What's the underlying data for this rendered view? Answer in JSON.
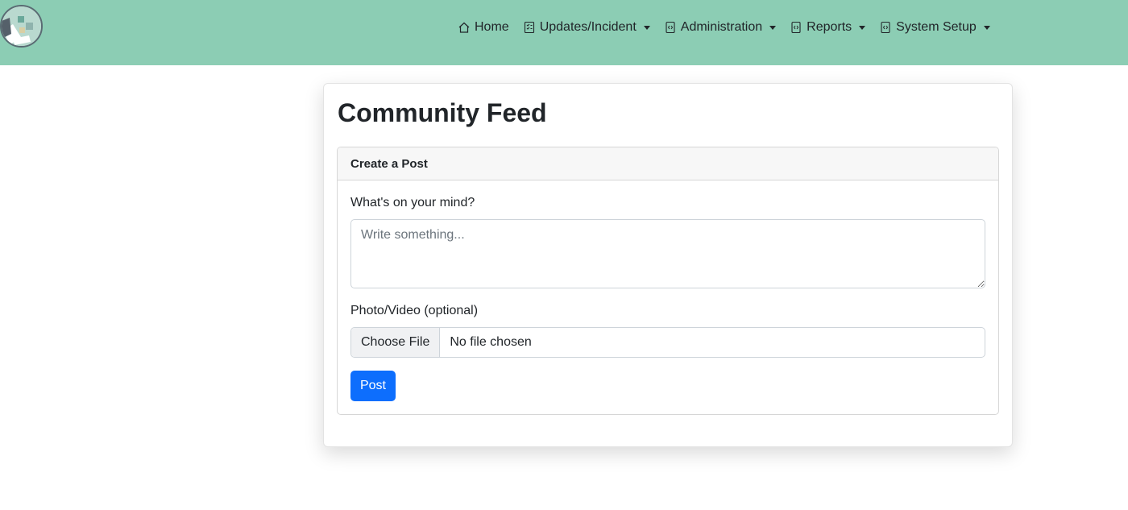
{
  "nav": {
    "items": [
      {
        "label": "Home",
        "icon": "house-icon",
        "dropdown": false
      },
      {
        "label": "Updates/Incident",
        "icon": "checklist-icon",
        "dropdown": true
      },
      {
        "label": "Administration",
        "icon": "file-code-icon",
        "dropdown": true
      },
      {
        "label": "Reports",
        "icon": "file-code-icon",
        "dropdown": true
      },
      {
        "label": "System Setup",
        "icon": "file-code-icon",
        "dropdown": true
      }
    ]
  },
  "page": {
    "title": "Community Feed"
  },
  "post_card": {
    "header": "Create a Post",
    "mind_label": "What's on your mind?",
    "mind_placeholder": "Write something...",
    "mind_value": "",
    "media_label": "Photo/Video (optional)",
    "file_button": "Choose File",
    "file_status": "No file chosen",
    "submit_label": "Post"
  },
  "colors": {
    "navbar": "#8ccdb4",
    "primary": "#0d6efd"
  }
}
